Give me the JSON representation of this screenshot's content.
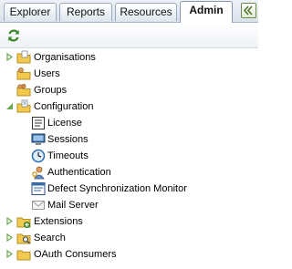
{
  "tabs": [
    {
      "label": "Explorer",
      "active": false
    },
    {
      "label": "Reports",
      "active": false
    },
    {
      "label": "Resources",
      "active": false
    },
    {
      "label": "Admin",
      "active": true
    }
  ],
  "toolbar": {
    "refresh_icon": "refresh-icon"
  },
  "tree": {
    "organisations": "Organisations",
    "users": "Users",
    "groups": "Groups",
    "configuration": "Configuration",
    "license": "License",
    "sessions": "Sessions",
    "timeouts": "Timeouts",
    "authentication": "Authentication",
    "defect_sync": "Defect Synchronization Monitor",
    "mail_server": "Mail Server",
    "extensions": "Extensions",
    "search": "Search",
    "oauth": "OAuth Consumers"
  },
  "colors": {
    "folder": "#f2c94c",
    "expander": "#6aa84f",
    "accent": "#3a6ea5"
  }
}
